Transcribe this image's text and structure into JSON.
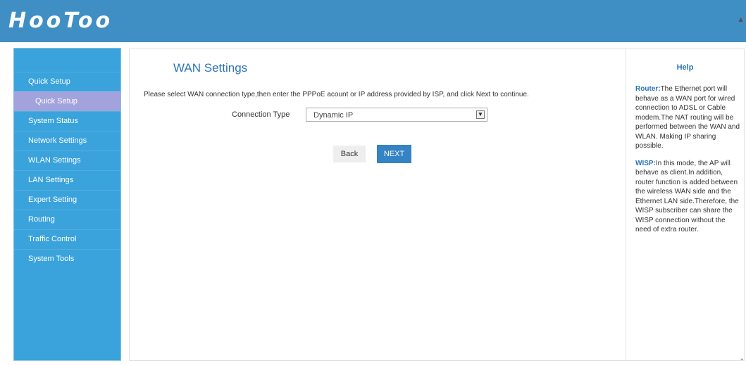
{
  "header": {
    "logo_text": "HooToo",
    "bg_color": "#3f8ec4"
  },
  "sidebar": {
    "items": [
      {
        "label": "Quick Setup"
      },
      {
        "label": "Quick Setup"
      },
      {
        "label": "System Status"
      },
      {
        "label": "Network Settings"
      },
      {
        "label": "WLAN Settings"
      },
      {
        "label": "LAN Settings"
      },
      {
        "label": "Expert Setting"
      },
      {
        "label": "Routing"
      },
      {
        "label": "Traffic Control"
      },
      {
        "label": "System Tools"
      }
    ],
    "active_index": 1,
    "bg_color": "#3aa3dc",
    "active_bg_color": "#a2a3dd"
  },
  "main": {
    "title": "WAN Settings",
    "instruction": "Please select WAN connection type,then enter the PPPoE acount or IP address provided by ISP, and click Next to continue.",
    "connection_type_label": "Connection Type",
    "connection_type_value": "Dynamic IP",
    "back_label": "Back",
    "next_label": "NEXT"
  },
  "help": {
    "title": "Help",
    "router_term": "Router:",
    "router_text": "The Ethernet port will behave as a WAN port for wired connection to ADSL or Cable modem.The NAT routing will be performed between the WAN and WLAN. Making IP sharing possible.",
    "wisp_term": "WISP:",
    "wisp_text": "In this mode, the AP will behave as client.In addition, router function is added between the wireless WAN side and the Ethernet LAN side.Therefore, the WISP subscriber can share the WISP connection without the need of extra router."
  },
  "icons": {
    "scroll_up": "scroll-up-arrow-icon",
    "scroll_down": "scroll-down-arrow-icon",
    "dropdown": "chevron-down-icon"
  }
}
